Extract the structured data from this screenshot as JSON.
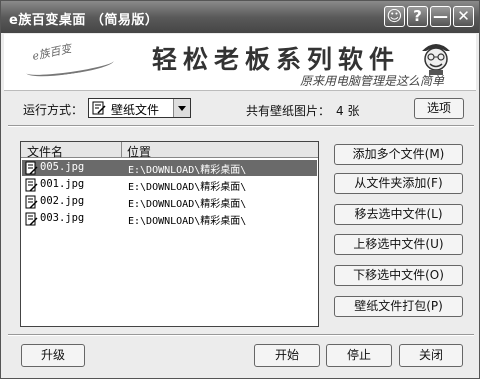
{
  "window": {
    "title": "e族百变桌面 （简易版）"
  },
  "titlebar_buttons": [
    {
      "name": "help-smiley-button",
      "glyph": "☺"
    },
    {
      "name": "help-button",
      "glyph": "?"
    },
    {
      "name": "minimize-button",
      "glyph": "—"
    },
    {
      "name": "close-window-button",
      "glyph": "✕"
    }
  ],
  "banner": {
    "logo_text": "e族百变",
    "slogan": "轻松老板系列软件",
    "subslogan": "原来用电脑管理是这么简单"
  },
  "toolbar": {
    "run_mode_label": "运行方式：",
    "run_mode_value": "壁纸文件",
    "count_label": "共有壁纸图片：",
    "count_value": "4 张",
    "options_button": "选项"
  },
  "file_list": {
    "columns": [
      "文件名",
      "位置"
    ],
    "rows": [
      {
        "name": "005.jpg",
        "path": "E:\\DOWNLOAD\\精彩桌面\\",
        "selected": true
      },
      {
        "name": "001.jpg",
        "path": "E:\\DOWNLOAD\\精彩桌面\\",
        "selected": false
      },
      {
        "name": "002.jpg",
        "path": "E:\\DOWNLOAD\\精彩桌面\\",
        "selected": false
      },
      {
        "name": "003.jpg",
        "path": "E:\\DOWNLOAD\\精彩桌面\\",
        "selected": false
      }
    ]
  },
  "side_buttons": {
    "add_files": "添加多个文件(M)",
    "add_folder": "从文件夹添加(F)",
    "remove": "移去选中文件(L)",
    "move_up": "上移选中文件(U)",
    "move_down": "下移选中文件(O)",
    "pack": "壁纸文件打包(P)"
  },
  "bottom_buttons": {
    "upgrade": "升级",
    "start": "开始",
    "stop": "停止",
    "close": "关闭"
  }
}
